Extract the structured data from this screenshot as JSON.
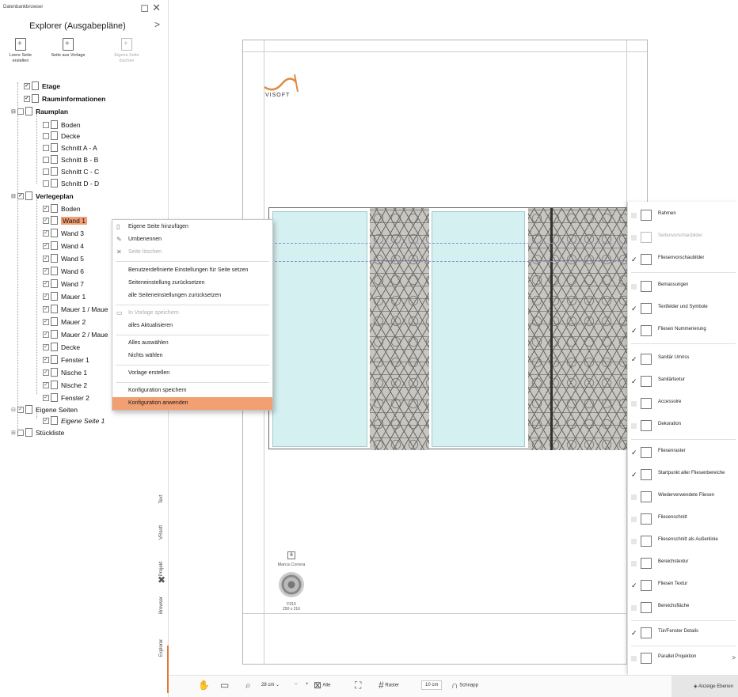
{
  "panel": {
    "window_title": "Datenbankbrowser",
    "header_title": "Explorer (Ausgabepläne)",
    "header_chevron": ">",
    "tools": [
      {
        "label": "Leere Seite erstellen"
      },
      {
        "label": "Seite aus Vorlage"
      },
      {
        "label": "Eigene Seite löschen"
      }
    ],
    "tree": [
      {
        "label": "Etage"
      },
      {
        "label": "Rauminformationen"
      },
      {
        "label": "Raumplan"
      },
      {
        "label": "Boden"
      },
      {
        "label": "Decke"
      },
      {
        "label": "Schnitt A - A"
      },
      {
        "label": "Schnitt B - B"
      },
      {
        "label": "Schnitt C - C"
      },
      {
        "label": "Schnitt D - D"
      },
      {
        "label": "Verlegeplan"
      },
      {
        "label": "Boden"
      },
      {
        "label": "Wand 1"
      },
      {
        "label": "Wand 3"
      },
      {
        "label": "Wand 4"
      },
      {
        "label": "Wand 5"
      },
      {
        "label": "Wand 6"
      },
      {
        "label": "Wand 7"
      },
      {
        "label": "Mauer 1"
      },
      {
        "label": "Mauer 1 / Maue"
      },
      {
        "label": "Mauer 2"
      },
      {
        "label": "Mauer 2 / Maue"
      },
      {
        "label": "Decke"
      },
      {
        "label": "Fenster 1"
      },
      {
        "label": "Nische 1"
      },
      {
        "label": "Nische 2"
      },
      {
        "label": "Fenster 2"
      },
      {
        "label": "Eigene Seiten"
      },
      {
        "label": "Eigene Seite 1"
      },
      {
        "label": "Stückliste"
      }
    ],
    "vtabs": [
      "Text",
      "VRsoft",
      "Projekt",
      "Browser",
      "Explorer"
    ]
  },
  "context_menu": [
    {
      "label": "Eigene Seite hinzufügen"
    },
    {
      "label": "Umbenennen"
    },
    {
      "label": "Seite löschen"
    },
    {
      "label": "Benutzerdefinierte Einstellungen für Seite setzen"
    },
    {
      "label": "Seiteneinstellung zurücksetzen"
    },
    {
      "label": "alle Seiteneinstellungen zurücksetzen"
    },
    {
      "label": "In Vorlage speichern"
    },
    {
      "label": "alles Aktualisieren"
    },
    {
      "label": "Alles auswählen"
    },
    {
      "label": "Nichts wählen"
    },
    {
      "label": "Vorlage erstellen"
    },
    {
      "label": "Konfiguration speichern"
    },
    {
      "label": "Konfiguration anwenden"
    }
  ],
  "page": {
    "logo_text": "VISOFT",
    "legend_marker": "6",
    "legend_brand": "Marca Corona",
    "legend_code": "F919",
    "legend_size": "250 x 216"
  },
  "layers": [
    {
      "label": "Rahmen",
      "checked": false
    },
    {
      "label": "Seitenvorschaubilder",
      "checked": false
    },
    {
      "label": "Fliesenvorschaubilder",
      "checked": true
    },
    {
      "label": "Bemassungen",
      "checked": false
    },
    {
      "label": "Textfelder und Symbole",
      "checked": true
    },
    {
      "label": "Fliesen Nummerierung",
      "checked": true
    },
    {
      "label": "Sanitär Umriss",
      "checked": true
    },
    {
      "label": "Sanitärtextur",
      "checked": true
    },
    {
      "label": "Accessoire",
      "checked": false
    },
    {
      "label": "Dekoration",
      "checked": false
    },
    {
      "label": "Fliesenraster",
      "checked": true
    },
    {
      "label": "Startpunkt aller Fliesenbereiche",
      "checked": true
    },
    {
      "label": "Wiederverwendete Fliesen",
      "checked": false
    },
    {
      "label": "Fliesenschnitt",
      "checked": false
    },
    {
      "label": "Fliesenschnitt als Außenlinie",
      "checked": false
    },
    {
      "label": "Bereichstextur",
      "checked": false
    },
    {
      "label": "Fliesen Textur",
      "checked": true
    },
    {
      "label": "Bereichsfläche",
      "checked": false
    },
    {
      "label": "Tür/Fenster Details",
      "checked": true
    },
    {
      "label": "Parallel Projektion",
      "checked": false
    }
  ],
  "bottombar": {
    "zoom_value": "28 cm",
    "zoom_minus": "−",
    "zoom_plus": "+",
    "fit_all": "Alle",
    "grid_label": "Raster",
    "grid_value": "10 cm",
    "snap_label": "Schnapp",
    "show_layers": "Anzeige Ebenen"
  },
  "colors": {
    "accent": "#f2a073",
    "glass": "#d5f0f1",
    "active_tab": "#e07838"
  }
}
